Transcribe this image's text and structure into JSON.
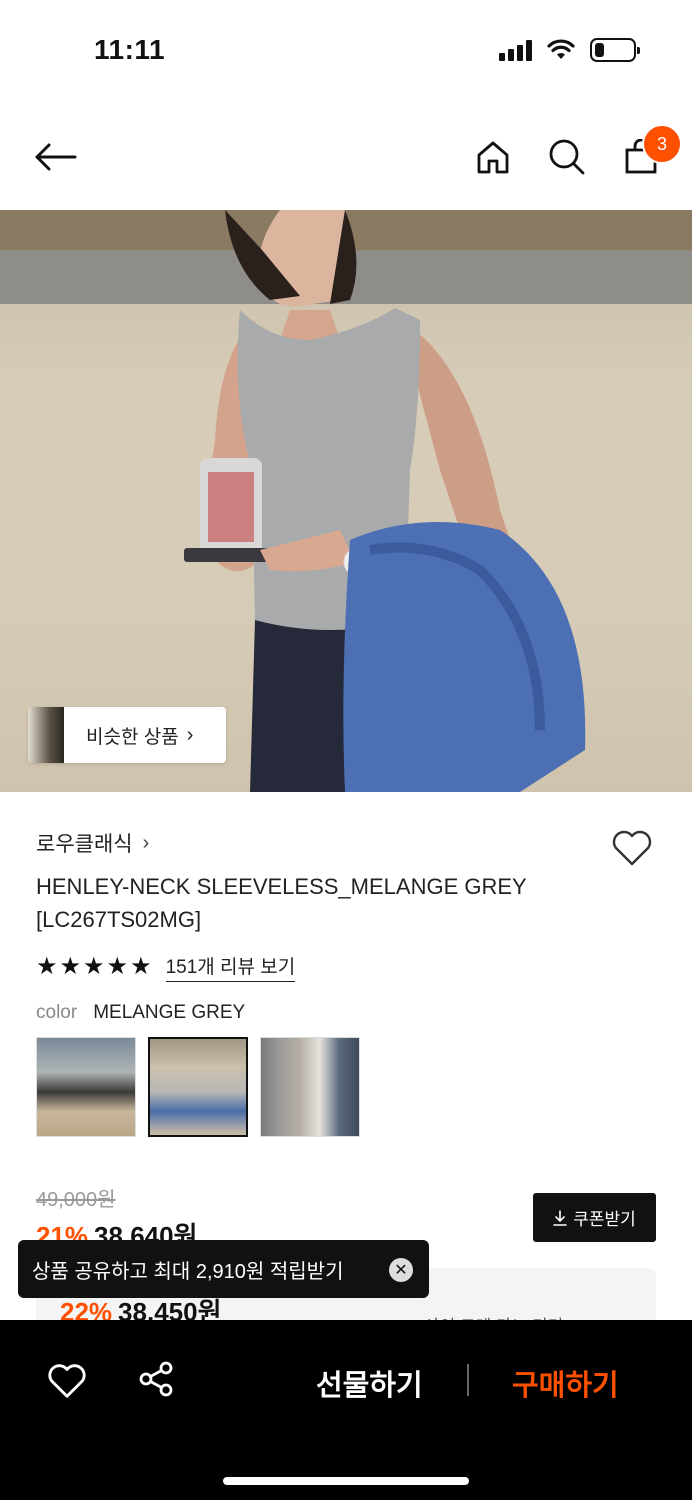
{
  "status": {
    "time": "11:11"
  },
  "header": {
    "cart_count": "3"
  },
  "hero": {
    "similar_label": "비슷한 상품"
  },
  "product": {
    "brand": "로우클래식",
    "name_line1": "HENLEY-NECK SLEEVELESS_MELANGE GREY",
    "name_line2": "[LC267TS02MG]",
    "stars": 5,
    "review_link": "151개 리뷰 보기",
    "color_key": "color",
    "color_value": "MELANGE GREY",
    "swatches": [
      {
        "name": "swatch-1",
        "selected": false
      },
      {
        "name": "swatch-2",
        "selected": true
      },
      {
        "name": "swatch-3",
        "selected": false
      }
    ]
  },
  "price": {
    "original": "49,000원",
    "discount_pct": "21%",
    "sale": "38,640원",
    "coupon_label": "쿠폰받기",
    "benefit_pct": "22%",
    "benefit_price": "38,450원",
    "benefit_text": "사이 크레 가느 기기"
  },
  "toast": {
    "text": "상품 공유하고 최대 2,910원 적립받기"
  },
  "bottom_bar": {
    "gift_label": "선물하기",
    "buy_label": "구매하기"
  },
  "colors": {
    "accent": "#ff5000",
    "dark": "#111111"
  }
}
